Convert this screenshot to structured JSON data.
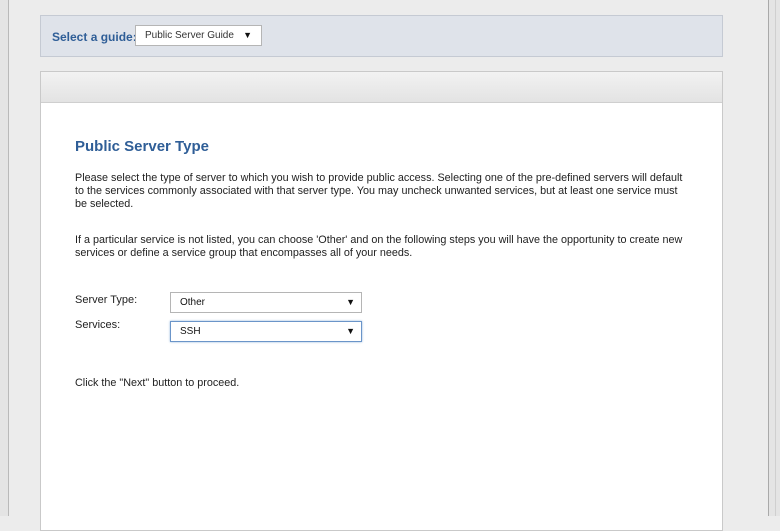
{
  "guide": {
    "label": "Select a guide:",
    "selected": "Public Server Guide"
  },
  "main": {
    "title": "Public Server Type",
    "paragraph1": "Please select the type of server to which you wish to provide public access. Selecting one of the pre-defined servers will default to the services commonly associated with that server type. You may uncheck unwanted services, but at least one service must be selected.",
    "paragraph2": "If a particular service is not listed, you can choose 'Other' and on the following steps you will have the opportunity to create new services or define a service group that encompasses all of your needs.",
    "server_type_label": "Server Type:",
    "server_type_value": "Other",
    "services_label": "Services:",
    "services_value": "SSH",
    "next_hint": "Click the \"Next\" button to proceed."
  },
  "icons": {
    "dropdown": "▼"
  }
}
